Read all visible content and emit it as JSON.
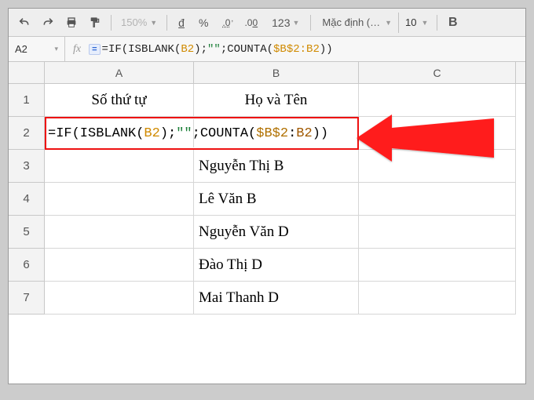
{
  "toolbar": {
    "zoom": "150%",
    "currency": "đ",
    "percent": "%",
    "dec_dec": ".0",
    "dec_inc": ".00",
    "more_fmt": "123",
    "font_name": "Mặc định (…",
    "font_size": "10",
    "bold": "B"
  },
  "namebox": {
    "ref": "A2"
  },
  "fx_label": "fx",
  "formula_bar": {
    "eq": "=",
    "t1": "=IF(ISBLANK(",
    "r1": "B2",
    "t2": ");",
    "str": "\"\"",
    "t3": ";COUNTA(",
    "r2": "$B$2:B2",
    "t4": "))"
  },
  "inline": {
    "t1": "=IF(ISBLANK(",
    "r1": "B2",
    "t2": ");",
    "str": "\"\"",
    "t3": ";COUNTA(",
    "r2a": "$B$2",
    "colon": ":",
    "r2b": "B2",
    "t4": "))"
  },
  "columns": {
    "A": "A",
    "B": "B",
    "C": "C"
  },
  "rows": {
    "1": {
      "num": "1",
      "A": "Số thứ tự",
      "B": "Họ và Tên",
      "C": ""
    },
    "2": {
      "num": "2",
      "A": "",
      "B": "",
      "C": ""
    },
    "3": {
      "num": "3",
      "A": "",
      "B": "Nguyễn Thị B",
      "C": ""
    },
    "4": {
      "num": "4",
      "A": "",
      "B": "Lê Văn B",
      "C": ""
    },
    "5": {
      "num": "5",
      "A": "",
      "B": "Nguyễn Văn D",
      "C": ""
    },
    "6": {
      "num": "6",
      "A": "",
      "B": "Đào Thị D",
      "C": ""
    },
    "7": {
      "num": "7",
      "A": "",
      "B": "Mai Thanh D",
      "C": ""
    }
  }
}
